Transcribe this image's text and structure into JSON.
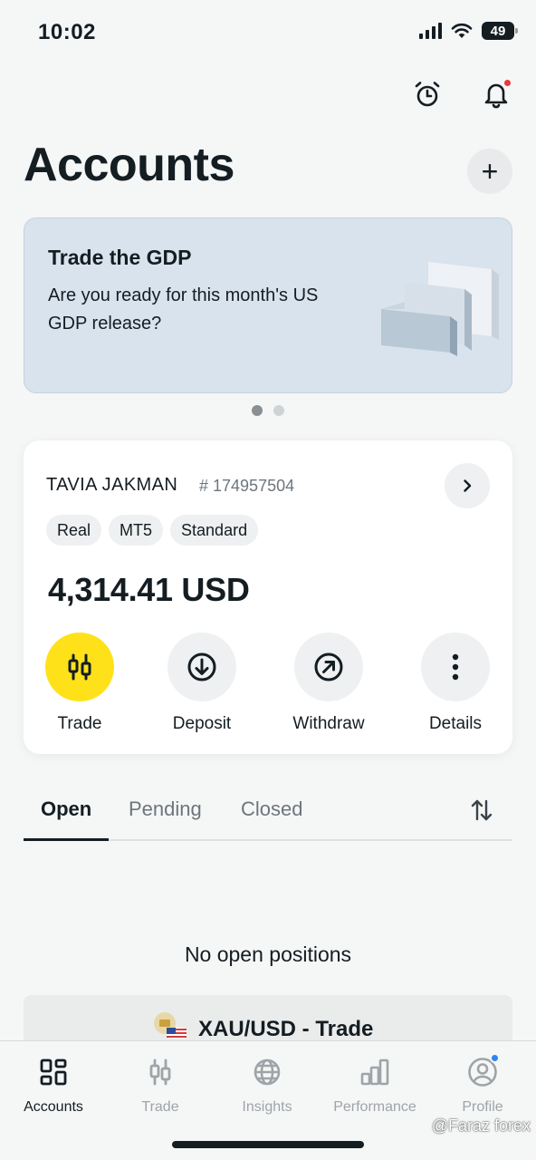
{
  "status_bar": {
    "time": "10:02",
    "battery": "49"
  },
  "header": {
    "title": "Accounts",
    "add_label": "+"
  },
  "banner": {
    "title": "Trade the GDP",
    "text": "Are you ready for this month's US GDP release?",
    "pages": 2,
    "active_page": 1
  },
  "account": {
    "name": "TAVIA JAKMAN",
    "number": "# 174957504",
    "tags": [
      "Real",
      "MT5",
      "Standard"
    ],
    "balance": "4,314.41 USD",
    "actions": [
      {
        "label": "Trade",
        "icon": "candlestick-icon"
      },
      {
        "label": "Deposit",
        "icon": "arrow-down-circle-icon"
      },
      {
        "label": "Withdraw",
        "icon": "arrow-up-right-circle-icon"
      },
      {
        "label": "Details",
        "icon": "more-vertical-icon"
      }
    ]
  },
  "tabs": {
    "items": [
      "Open",
      "Pending",
      "Closed"
    ],
    "active": "Open"
  },
  "positions": {
    "empty_text": "No open positions"
  },
  "promo": {
    "text": "XAU/USD - Trade"
  },
  "bottom_nav": {
    "items": [
      {
        "label": "Accounts",
        "icon": "accounts-grid-icon"
      },
      {
        "label": "Trade",
        "icon": "candlestick-icon"
      },
      {
        "label": "Insights",
        "icon": "globe-icon"
      },
      {
        "label": "Performance",
        "icon": "bar-chart-icon"
      },
      {
        "label": "Profile",
        "icon": "user-circle-icon"
      }
    ],
    "active": "Accounts"
  },
  "watermark": "@Faraz forex",
  "colors": {
    "accent_yellow": "#ffe11a",
    "text": "#141d22",
    "muted": "#6d767c",
    "notification_red": "#e63a3a",
    "profile_badge_blue": "#2b87f5",
    "banner_bg": "#d9e3ee"
  }
}
